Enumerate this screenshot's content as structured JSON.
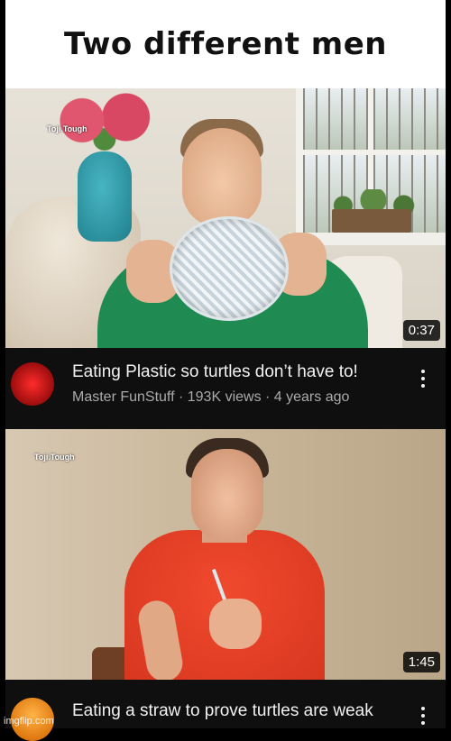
{
  "meme": {
    "title": "Two different men"
  },
  "videos": [
    {
      "watermark": "Toji.Tough",
      "duration": "0:37",
      "title": "Eating Plastic so turtles don’t have to!",
      "channel": "Master FunStuff",
      "views": "193K views",
      "age": "4 years ago",
      "subline": "Master FunStuff · 193K views · 4 years ago"
    },
    {
      "watermark": "Toji.Tough",
      "duration": "1:45",
      "title": "Eating a straw to prove turtles are weak"
    }
  ],
  "footer": {
    "imgflip": "imgflip.com"
  }
}
